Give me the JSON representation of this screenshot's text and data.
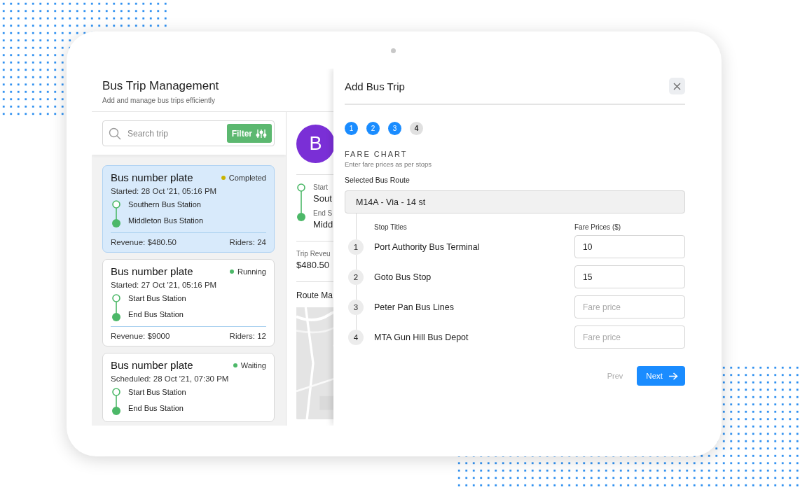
{
  "header": {
    "title": "Bus Trip Management",
    "subtitle": "Add and manage bus trips efficiently"
  },
  "search": {
    "placeholder": "Search trip",
    "filter_label": "Filter"
  },
  "trips": [
    {
      "title": "Bus number plate",
      "status": "Completed",
      "color": "#c9b300",
      "time": "Started: 28 Oct '21, 05:16 PM",
      "start": "Southern Bus Station",
      "end": "Middleton Bus Station",
      "revenue": "Revenue: $480.50",
      "riders": "Riders: 24",
      "selected": true
    },
    {
      "title": "Bus number plate",
      "status": "Running",
      "color": "#4cb868",
      "time": "Started: 27 Oct '21, 05:16 PM",
      "start": "Start Bus Station",
      "end": "End Bus Station",
      "revenue": "Revenue: $9000",
      "riders": "Riders: 12",
      "selected": false
    },
    {
      "title": "Bus number plate",
      "status": "Waiting",
      "color": "#4cb868",
      "time": "Scheduled: 28 Oct '21, 07:30 PM",
      "start": "Start Bus Station",
      "end": "End Bus Station",
      "selected": false
    }
  ],
  "detail": {
    "avatar": "B",
    "start_label": "Start",
    "start_value": "Sout",
    "end_label": "End S",
    "end_value": "Midd",
    "revenue_label": "Trip Reveu",
    "revenue_value": "$480.50",
    "map_title": "Route Ma"
  },
  "modal": {
    "title": "Add Bus Trip",
    "steps": [
      {
        "label": "1",
        "completed": true
      },
      {
        "label": "2",
        "completed": true
      },
      {
        "label": "3",
        "completed": true
      },
      {
        "label": "4",
        "completed": false
      }
    ],
    "section_title": "FARE CHART",
    "section_hint": "Enter fare prices as per stops",
    "route_label": "Selected Bus Route",
    "route_value": "M14A - Via - 14 st",
    "columns": [
      "Stop Titles",
      "Fare Prices ($)"
    ],
    "stops": [
      {
        "number": "1",
        "title": "Port Authority Bus Terminal",
        "value": "10"
      },
      {
        "number": "2",
        "title": "Goto Bus Stop",
        "value": "15"
      },
      {
        "number": "3",
        "title": "Peter Pan Bus Lines",
        "placeholder": "Fare price"
      },
      {
        "number": "4",
        "title": "MTA Gun Hill Bus Depot",
        "placeholder": "Fare price"
      }
    ],
    "prev": "Prev",
    "next": "Next"
  }
}
